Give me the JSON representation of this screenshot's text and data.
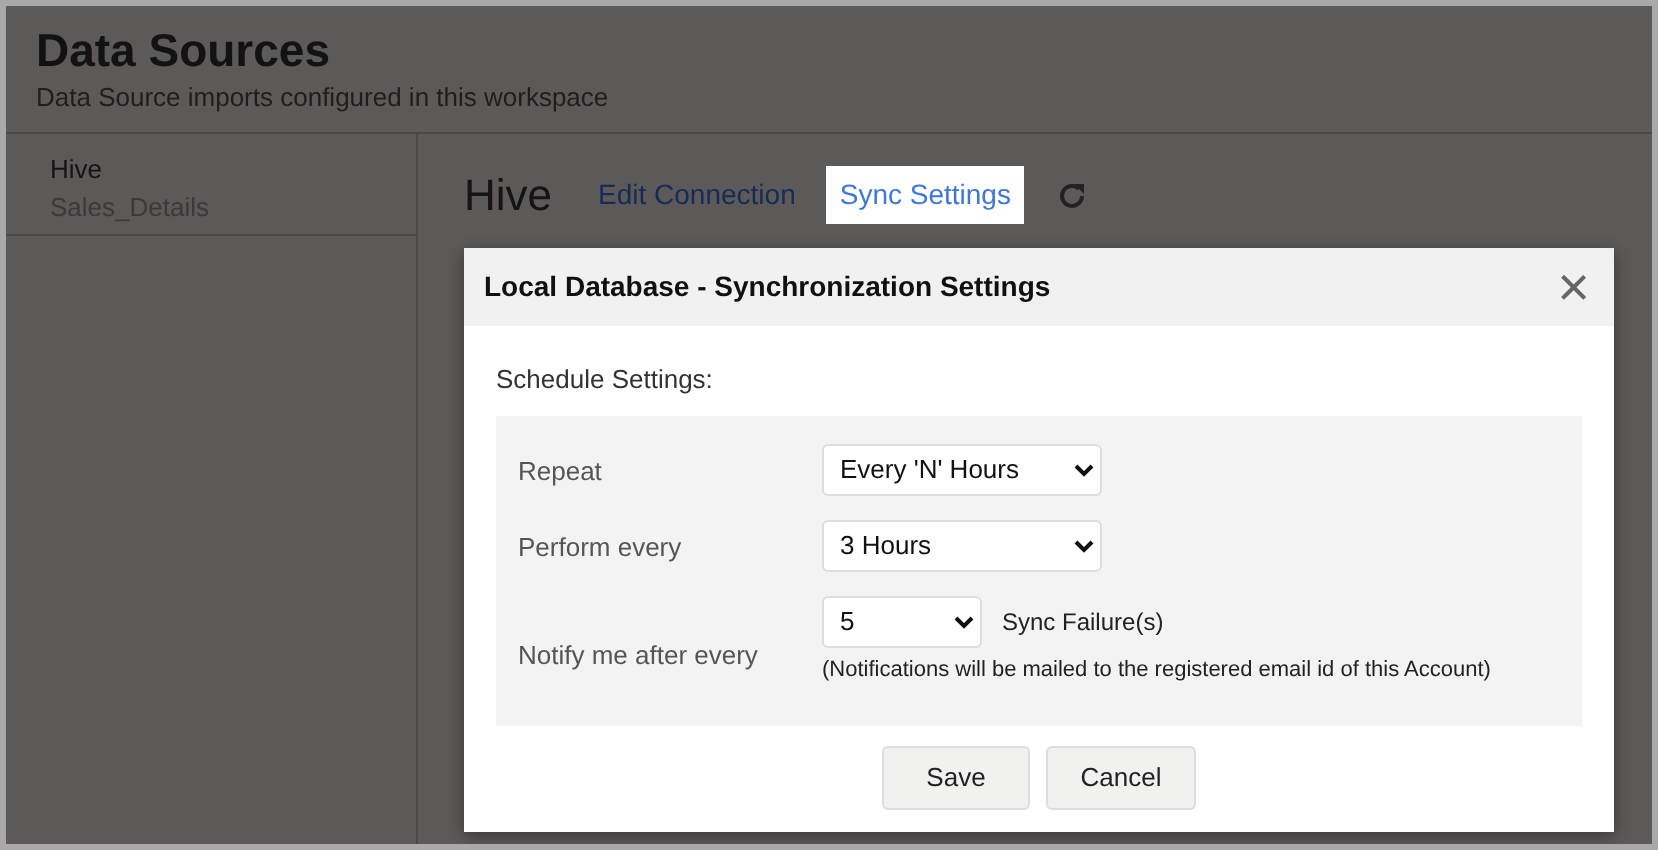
{
  "header": {
    "title": "Data Sources",
    "subtitle": "Data Source imports configured in this workspace"
  },
  "sidebar": {
    "items": [
      {
        "label": "Hive",
        "selected": true
      },
      {
        "label": "Sales_Details",
        "selected": false
      }
    ]
  },
  "main": {
    "title": "Hive",
    "actions": [
      {
        "label": "Edit Connection",
        "selected": false
      },
      {
        "label": "Sync Settings",
        "selected": true
      }
    ]
  },
  "dialog": {
    "title": "Local Database - Synchronization Settings",
    "close": "×",
    "section": "Schedule Settings:",
    "rows": [
      {
        "label": "Repeat",
        "value": "Every 'N' Hours",
        "kind": "wide"
      },
      {
        "label": "Perform every",
        "value": "3 Hours",
        "kind": "wide"
      },
      {
        "label": "Notify me after every",
        "value": "5",
        "kind": "narrow",
        "suffix": "Sync Failure(s)",
        "note": "(Notifications will be mailed to the registered email id of this Account)"
      }
    ],
    "buttons": [
      "Save",
      "Cancel"
    ]
  }
}
